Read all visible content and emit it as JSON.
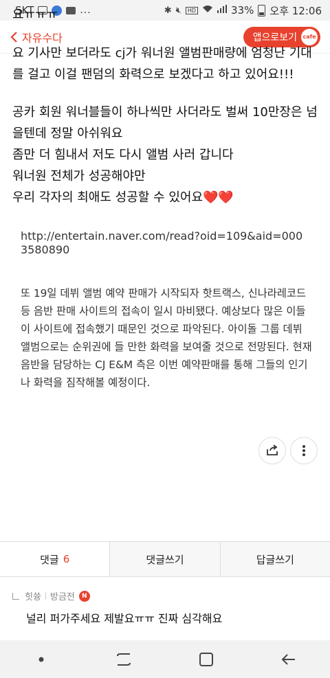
{
  "status_bar": {
    "carrier": "SKT",
    "more": "...",
    "hd_voice": "HD",
    "battery": "33%",
    "time": "오후 12:06"
  },
  "header": {
    "back_label": "자유수다",
    "app_button_label": "앱으로보기",
    "cafe_badge": "cafe",
    "accent_color": "#e8422e"
  },
  "post": {
    "line1": "요ㅠㅠㅠ",
    "para2": "요 기사만 보더라도 cj가 워너원 앨범판매량에 엄청난 기대를 걸고 이걸 팬덤의 화력으로 보겠다고 하고 있어요!!!",
    "para3_lines": [
      "공카 회원 워너블들이 하나씩만 사더라도 벌써 10만장은 넘을텐데 정말 아쉬워요",
      "좀만 더 힘내서 저도 다시 앨범 사러 갑니다",
      "워너원 전체가 성공해야만",
      "우리 각자의 최애도 성공할 수 있어요"
    ],
    "hearts": "❤️❤️",
    "link": "http://entertain.naver.com/read?oid=109&aid=0003580890",
    "article": "또 19일 데뷔 앨범 예약 판매가 시작되자 핫트랙스, 신나라레코드 등 음반 판매 사이트의 접속이 일시 마비됐다. 예상보다 많은 이들이 사이트에 접속했기 때문인 것으로 파악된다. 아이돌 그룹 데뷔 앨범으로는 순위권에 들 만한 화력을 보여줄 것으로 전망된다. 현재 음반을 담당하는 CJ E&M 측은 이번 예약판매를 통해 그들의 인기나 화력을 짐작해볼 예정이다."
  },
  "actions": {
    "share_icon": "share-icon",
    "more_icon": "more-vertical-icon"
  },
  "tabs": {
    "comments_label": "댓글",
    "comments_count": "6",
    "write_comment_label": "댓글쓰기",
    "write_reply_label": "답글쓰기"
  },
  "comment": {
    "author": "힛쓩",
    "time": "방금전",
    "new_badge": "N",
    "text": "널리 퍼가주세요 제발요ㅠㅠ 진짜 심각해요"
  }
}
